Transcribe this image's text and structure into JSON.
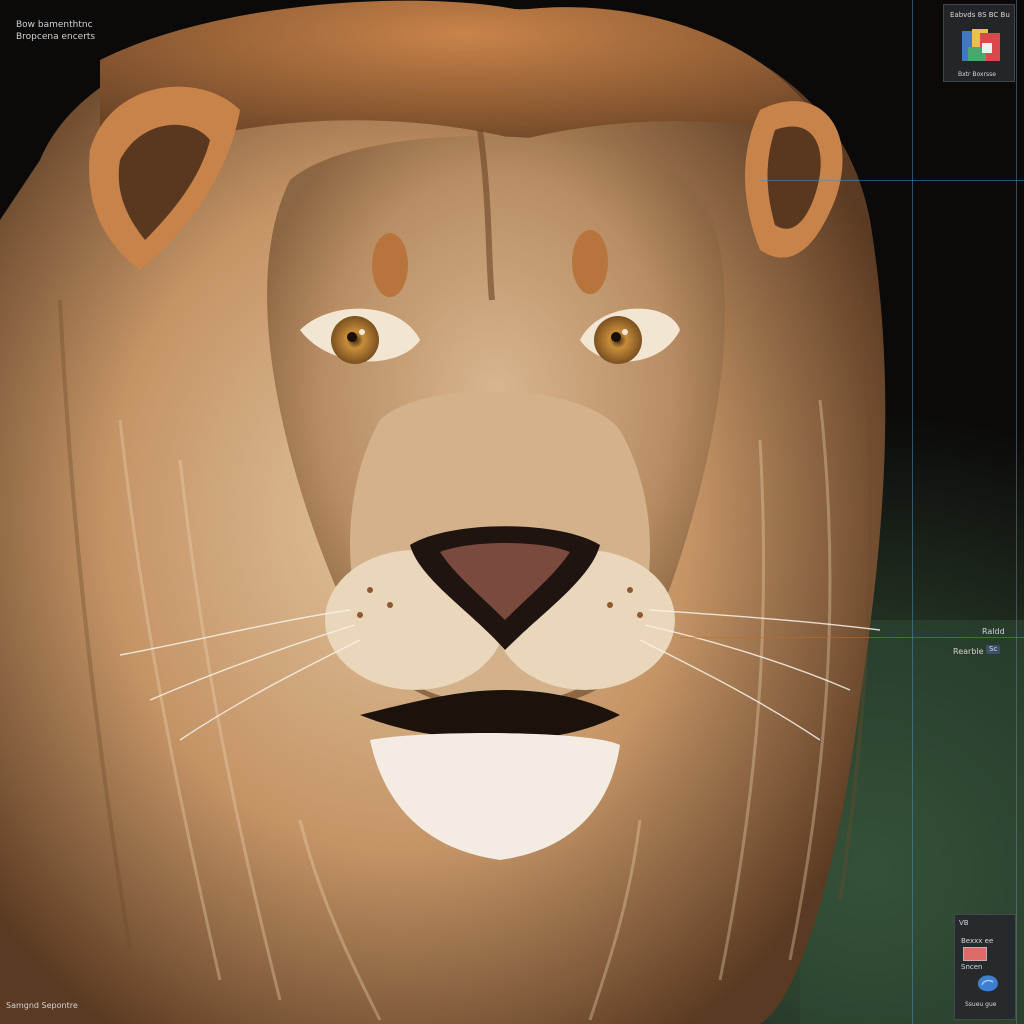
{
  "overlay": {
    "top_left_line1": "Bow bamenthtnc",
    "top_left_line2": "Bropcena encerts",
    "bottom_left": "Samgnd Sepontre"
  },
  "top_panel": {
    "title": "Eabvds 8S BC Bu",
    "caption": "Bxtr Boxrsse"
  },
  "mid_right": {
    "label": "Raldd",
    "field_label": "Rearble C",
    "chip": "Sc"
  },
  "bottom_panel": {
    "header": "VB",
    "line1": "Bexxx ee",
    "line2": "Sncen",
    "caption": "Ssueu gue"
  },
  "colors": {
    "mane_dark": "#5a3a22",
    "mane_light": "#d9b48a",
    "fur_face": "#c8a27a",
    "eye": "#b07a2c",
    "nose": "#7a4a3e",
    "background": "#0b0a09",
    "foliage": "#2f4a34",
    "guide": "#468cbe"
  },
  "icons": {
    "thumbnail": "color-swatch-thumbnail-icon",
    "bottom": "blue-blob-icon"
  }
}
